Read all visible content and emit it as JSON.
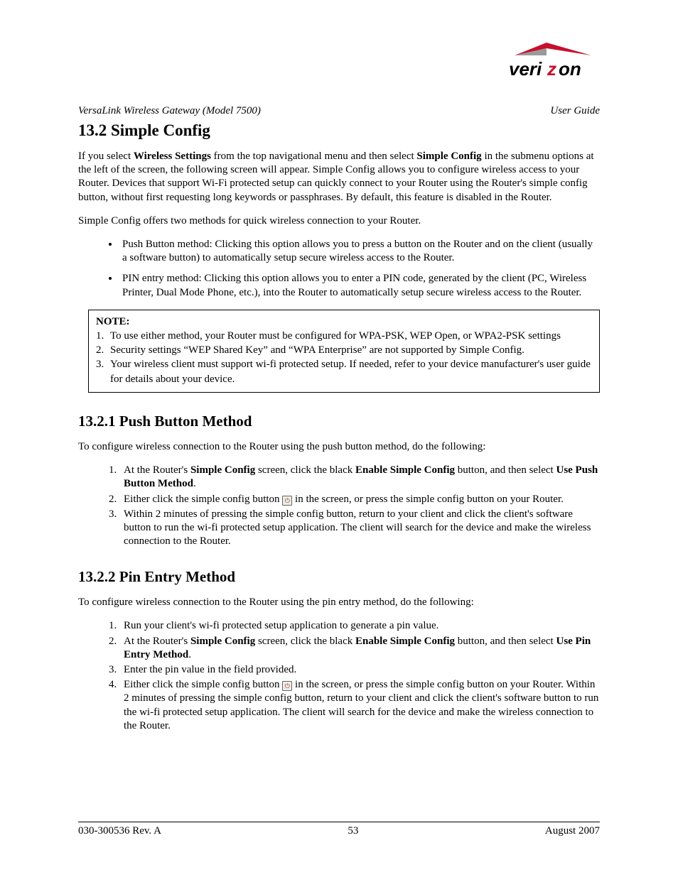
{
  "header": {
    "product": "VersaLink Wireless Gateway (Model 7500)",
    "doc_type": "User Guide",
    "brand_name": "verizon"
  },
  "section": {
    "number_title": "13.2 Simple Config",
    "intro_pre": "If you select ",
    "intro_bold1": "Wireless Settings",
    "intro_mid1": " from the top navigational menu and then select ",
    "intro_bold2": "Simple Config",
    "intro_post": " in the submenu options at the left of the screen, the following screen will appear. Simple Config allows you to configure wireless access to your Router. Devices that support Wi-Fi protected setup can quickly connect to your Router using the Router's simple config button, without first requesting long keywords or passphrases. By default, this feature is disabled in the Router.",
    "methods_lead": "Simple Config offers two methods for quick wireless connection to your Router.",
    "bullets": [
      "Push Button method: Clicking this option allows you to press a button on the Router and on the client (usually a software button) to automatically setup secure wireless access to the Router.",
      "PIN entry method: Clicking this option allows you to enter a PIN code, generated by the client (PC, Wireless Printer, Dual Mode Phone, etc.), into the Router to automatically setup secure wireless access to the Router."
    ],
    "note_label": "NOTE:",
    "note_items": [
      "To use either method, your Router must be configured for WPA-PSK, WEP Open, or WPA2-PSK settings",
      "Security settings “WEP Shared Key” and “WPA Enterprise” are not supported by Simple Config.",
      "Your wireless client must support wi-fi protected setup. If needed, refer to your device manufacturer's user guide for details about your device."
    ]
  },
  "sub1": {
    "title": "13.2.1 Push Button Method",
    "lead": "To configure wireless connection to the Router using the push button method, do the following:",
    "step1_a": "At the Router's ",
    "step1_b1": "Simple Config",
    "step1_b": " screen, click the black ",
    "step1_b2": "Enable Simple Config",
    "step1_c": " button, and then select ",
    "step1_b3": "Use Push Button Method",
    "step1_d": ".",
    "step2_a": "Either click the simple config button ",
    "step2_b": " in the screen, or press the simple config button on your Router.",
    "step3": "Within 2 minutes of pressing the simple config button, return to your client and click the client's software button to run the wi-fi protected setup application. The client will search for the device and make the wireless connection to the Router."
  },
  "sub2": {
    "title": "13.2.2 Pin Entry Method",
    "lead": "To configure wireless connection to the Router using the pin entry method, do the following:",
    "step1": "Run your client's wi-fi protected setup application to generate a pin value.",
    "step2_a": "At the Router's ",
    "step2_b1": "Simple Config",
    "step2_b": " screen, click the black ",
    "step2_b2": "Enable Simple Config",
    "step2_c": " button, and then select ",
    "step2_b3": "Use Pin Entry Method",
    "step2_d": ".",
    "step3": "Enter the pin value in the field provided.",
    "step4_a": "Either click the simple config button ",
    "step4_b": " in the screen, or press the simple config button on your Router. Within 2 minutes of pressing the simple config button, return to your client and click the client's software button to run the wi-fi protected setup application. The client will search for the device and make the wireless connection to the Router."
  },
  "footer": {
    "left": "030-300536 Rev. A",
    "center": "53",
    "right": "August 2007"
  }
}
